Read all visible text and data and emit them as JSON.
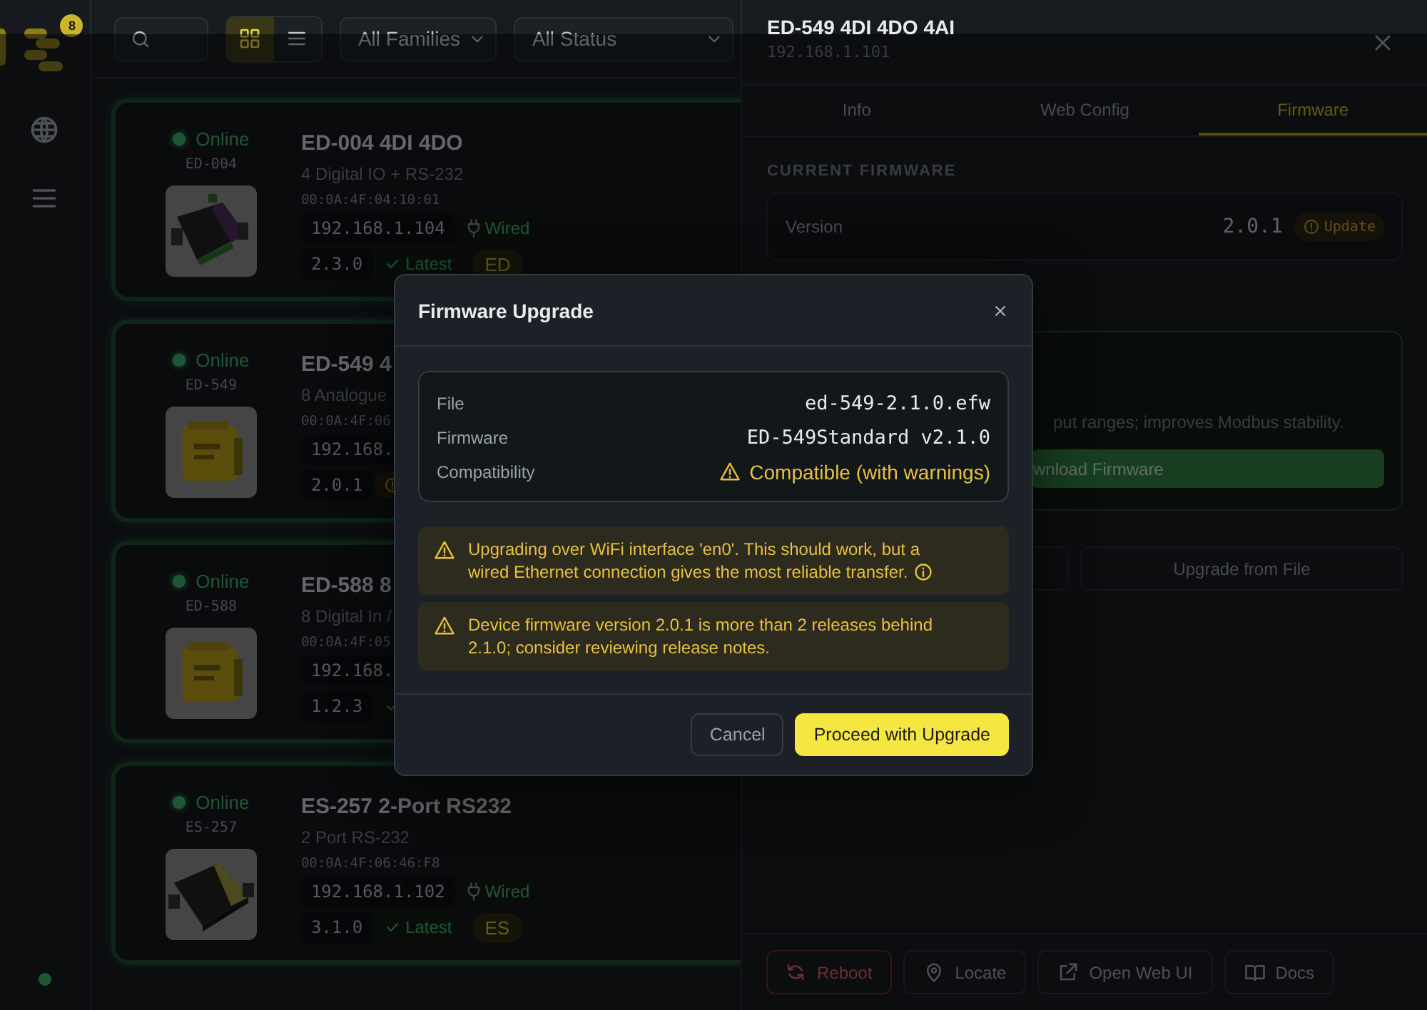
{
  "sidebar": {
    "badge": "8",
    "items": [
      {
        "kind": "network",
        "selected": false
      },
      {
        "kind": "menu",
        "selected": false
      }
    ]
  },
  "toolbar": {
    "view_modes": [
      {
        "kind": "grid",
        "selected": true
      },
      {
        "kind": "list",
        "selected": false
      }
    ],
    "filters": [
      {
        "value": "All Families"
      },
      {
        "value": "All Status"
      }
    ]
  },
  "devices": [
    {
      "status": "Online",
      "online": true,
      "model": "ED-004",
      "title": "ED-004 4DI 4DO",
      "subtitle": "4 Digital IO + RS-232",
      "mac": "00:0A:4F:04:10:01",
      "ip": "192.168.1.104",
      "connection": "Wired",
      "version": "2.3.0",
      "firmware_state": {
        "kind": "latest",
        "label": "Latest"
      },
      "family": "ED"
    },
    {
      "status": "Online",
      "online": true,
      "model": "ED-549",
      "title": "ED-549 4",
      "subtitle": "8 Analogue",
      "mac": "00:0A:4F:06",
      "ip": "192.168.",
      "version": "2.0.1",
      "firmware_state": {
        "kind": "update"
      }
    },
    {
      "status": "Online",
      "online": true,
      "model": "ED-588",
      "title": "ED-588 8",
      "subtitle": "8 Digital In /",
      "mac": "00:0A:4F:05",
      "ip": "192.168.",
      "version": "1.2.3",
      "firmware_state": {
        "kind": "latest"
      }
    },
    {
      "status": "Online",
      "online": true,
      "model": "ES-257",
      "title": "ES-257 2-Port RS232",
      "subtitle": "2 Port RS-232",
      "mac": "00:0A:4F:06:46:F8",
      "ip": "192.168.1.102",
      "connection": "Wired",
      "version": "3.1.0",
      "firmware_state": {
        "kind": "latest",
        "label": "Latest"
      },
      "family": "ES"
    }
  ],
  "detail_panel": {
    "title": "ED-549 4DI 4DO 4AI",
    "subtitle": "192.168.1.101",
    "tabs": [
      {
        "label": "Info",
        "selected": false
      },
      {
        "label": "Web Config",
        "selected": false
      },
      {
        "label": "Firmware",
        "selected": true
      }
    ],
    "section_title": "CURRENT FIRMWARE",
    "version_label": "Version",
    "version": "2.0.1",
    "update_badge": "Update",
    "release_note": "put ranges; improves Modbus stability.",
    "download_button": "wnload Firmware",
    "upload_button": "Upgrade from File",
    "actions": [
      {
        "kind": "reboot",
        "label": "Reboot"
      },
      {
        "kind": "locate",
        "label": "Locate"
      },
      {
        "kind": "open",
        "label": "Open Web UI"
      },
      {
        "kind": "docs",
        "label": "Docs"
      }
    ]
  },
  "dialog": {
    "title": "Firmware Upgrade",
    "details": [
      {
        "label": "File",
        "value": "ed-549-2.1.0.efw",
        "kind": "mono"
      },
      {
        "label": "Firmware",
        "value": "ED-549Standard v2.1.0",
        "kind": "mono"
      },
      {
        "label": "Compatibility",
        "value": "Compatible (with warnings)",
        "kind": "warning"
      }
    ],
    "warnings": [
      {
        "text": "Upgrading over WiFi interface 'en0'. This should work, but a wired Ethernet connection gives the most reliable transfer.",
        "info": true
      },
      {
        "text": "Device firmware version 2.0.1 is more than 2 releases behind 2.1.0; consider reviewing release notes.",
        "info": false
      }
    ],
    "buttons": [
      {
        "label": "Cancel",
        "primary": false
      },
      {
        "label": "Proceed with Upgrade",
        "primary": true
      }
    ]
  }
}
